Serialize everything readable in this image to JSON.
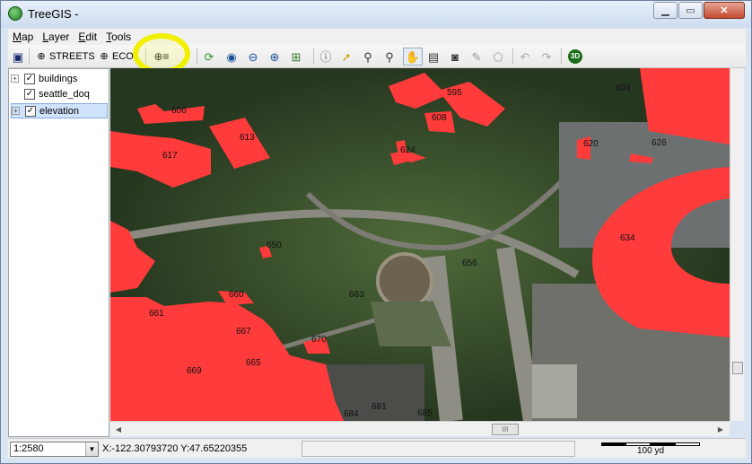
{
  "window": {
    "title": "TreeGIS -",
    "min_label": "▁",
    "max_label": "▭",
    "close_label": "✕"
  },
  "menu": [
    {
      "key": "M",
      "rest": "ap"
    },
    {
      "key": "L",
      "rest": "ayer"
    },
    {
      "key": "E",
      "rest": "dit"
    },
    {
      "key": "T",
      "rest": "ools"
    }
  ],
  "toolbar": {
    "save_icon": "floppy-disk-icon",
    "streets_label": "STREETS",
    "eco_label": "ECO",
    "add_layer_icon": "add-layer-icon",
    "refresh_icon": "refresh-icon",
    "full_extent_icon": "globe-zoom-icon",
    "zoom_out_icon": "zoom-out-icon",
    "zoom_in_icon": "zoom-in-icon",
    "zoom_layer_icon": "zoom-to-layer-icon",
    "info_icon": "info-icon",
    "select_icon": "select-arrow-icon",
    "magnifier_icon": "magnifier-icon",
    "magnifier2_icon": "magnifier-plus-icon",
    "pan_icon": "hand-pan-icon",
    "film_icon": "film-icon",
    "camera_icon": "camera-icon",
    "pencil_icon": "pencil-icon",
    "polygon_icon": "polygon-edit-icon",
    "undo_icon": "undo-icon",
    "redo_icon": "redo-icon",
    "threed_label": "3D"
  },
  "layers": [
    {
      "name": "buildings",
      "checked": true,
      "expandable": true,
      "selected": false
    },
    {
      "name": "seattle_doq",
      "checked": true,
      "expandable": false,
      "selected": false
    },
    {
      "name": "elevation",
      "checked": true,
      "expandable": true,
      "selected": true
    }
  ],
  "map": {
    "building_color": "#ff3b3b",
    "labels": [
      "595",
      "604",
      "606",
      "608",
      "613",
      "617",
      "620",
      "624",
      "626",
      "634",
      "650",
      "656",
      "660",
      "661",
      "663",
      "667",
      "669",
      "670",
      "681",
      "684",
      "685",
      "665"
    ]
  },
  "status": {
    "scale_value": "1:2580",
    "coordinates": "X:-122.30793720 Y:47.65220355",
    "scalebar_label": "100 yd"
  },
  "scrollbar": {
    "thumb_glyph": "III"
  }
}
